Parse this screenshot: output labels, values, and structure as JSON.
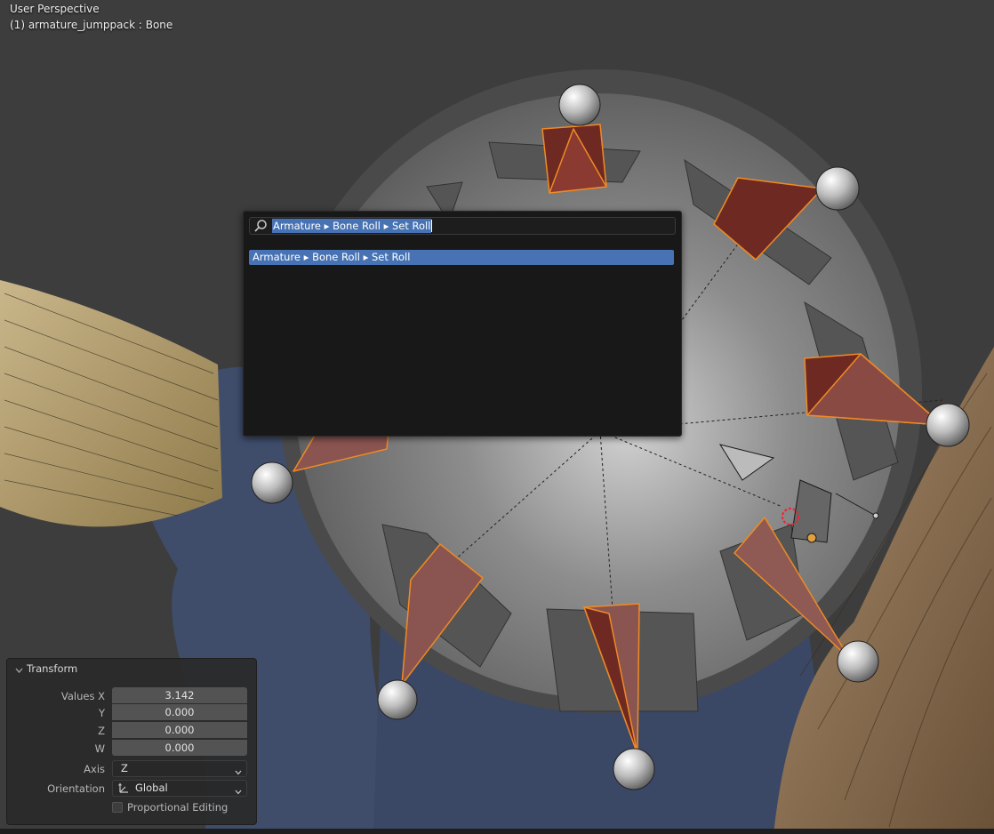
{
  "viewport": {
    "view_name": "User Perspective",
    "active_object": "(1) armature_jumppack : Bone"
  },
  "search": {
    "query": "Armature ▸ Bone Roll ▸ Set Roll",
    "result": "Armature ▸ Bone Roll ▸ Set Roll",
    "icon": "search-icon"
  },
  "transform": {
    "title": "Transform",
    "values_label": "Values X",
    "y_label": "Y",
    "z_label": "Z",
    "w_label": "W",
    "x": "3.142",
    "y": "0.000",
    "z": "0.000",
    "w": "0.000",
    "axis_label": "Axis",
    "axis_value": "Z",
    "orientation_label": "Orientation",
    "orientation_value": "Global",
    "proportional_label": "Proportional Editing",
    "proportional_checked": false
  },
  "colors": {
    "accent": "#4772b3",
    "bone_outline": "#f08a24",
    "bone_fill": "#6e2a22",
    "viewport_bg": "#3d3d3d"
  }
}
